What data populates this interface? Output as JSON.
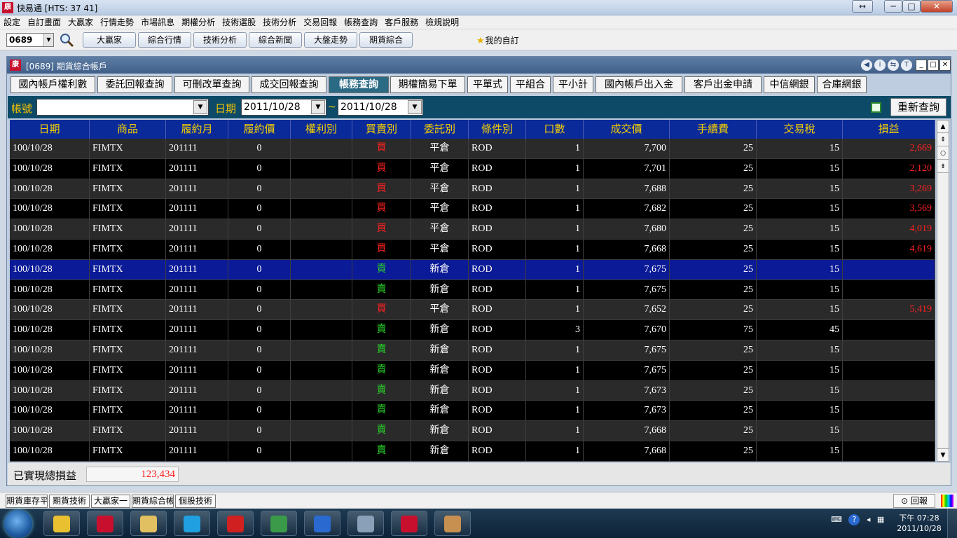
{
  "window": {
    "title": "快易通 [HTS: 37 41]",
    "controls": {
      "restore": "↔",
      "minimize": "─",
      "maximize": "□",
      "close": "✕"
    }
  },
  "menu": [
    "設定",
    "自訂畫面",
    "大贏家",
    "行情走勢",
    "市場訊息",
    "期權分析",
    "技術選股",
    "技術分析",
    "交易回報",
    "帳務查詢",
    "客戶服務",
    "檢規說明"
  ],
  "toolbar": {
    "stock_code": "0689",
    "buttons": [
      "大贏家",
      "綜合行情",
      "技術分析",
      "綜合新聞",
      "大盤走勢",
      "期貨綜合"
    ],
    "favorites_label": "我的自訂"
  },
  "subwindow": {
    "title": "[0689] 期貨綜合帳戶",
    "tabs": [
      "國內帳戶權利數",
      "委託回報查詢",
      "可刪改單查詢",
      "成交回報查詢",
      "帳務查詢",
      "期權簡易下單",
      "平單式",
      "平組合",
      "平小計",
      "國內帳戶出入金",
      "客戶出金申請",
      "中信網銀",
      "合庫網銀"
    ],
    "active_tab": "帳務查詢"
  },
  "filter": {
    "account_label": "帳號",
    "account_value": "",
    "date_label": "日期",
    "date_from": "2011/10/28",
    "separator": "~",
    "date_to": "2011/10/28",
    "requery_label": "重新查詢"
  },
  "table": {
    "columns": [
      "日期",
      "商品",
      "履約月",
      "履約價",
      "權利別",
      "買賣別",
      "委託別",
      "條件別",
      "口數",
      "成交價",
      "手續費",
      "交易稅",
      "損益"
    ],
    "rows": [
      [
        "100/10/28",
        "FIMTX",
        "201111",
        "0",
        "",
        "買",
        "平倉",
        "ROD",
        "1",
        "7,700",
        "25",
        "15",
        "2,669"
      ],
      [
        "100/10/28",
        "FIMTX",
        "201111",
        "0",
        "",
        "買",
        "平倉",
        "ROD",
        "1",
        "7,701",
        "25",
        "15",
        "2,120"
      ],
      [
        "100/10/28",
        "FIMTX",
        "201111",
        "0",
        "",
        "買",
        "平倉",
        "ROD",
        "1",
        "7,688",
        "25",
        "15",
        "3,269"
      ],
      [
        "100/10/28",
        "FIMTX",
        "201111",
        "0",
        "",
        "買",
        "平倉",
        "ROD",
        "1",
        "7,682",
        "25",
        "15",
        "3,569"
      ],
      [
        "100/10/28",
        "FIMTX",
        "201111",
        "0",
        "",
        "買",
        "平倉",
        "ROD",
        "1",
        "7,680",
        "25",
        "15",
        "4,019"
      ],
      [
        "100/10/28",
        "FIMTX",
        "201111",
        "0",
        "",
        "買",
        "平倉",
        "ROD",
        "1",
        "7,668",
        "25",
        "15",
        "4,619"
      ],
      [
        "100/10/28",
        "FIMTX",
        "201111",
        "0",
        "",
        "賣",
        "新倉",
        "ROD",
        "1",
        "7,675",
        "25",
        "15",
        ""
      ],
      [
        "100/10/28",
        "FIMTX",
        "201111",
        "0",
        "",
        "賣",
        "新倉",
        "ROD",
        "1",
        "7,675",
        "25",
        "15",
        ""
      ],
      [
        "100/10/28",
        "FIMTX",
        "201111",
        "0",
        "",
        "買",
        "平倉",
        "ROD",
        "1",
        "7,652",
        "25",
        "15",
        "5,419"
      ],
      [
        "100/10/28",
        "FIMTX",
        "201111",
        "0",
        "",
        "賣",
        "新倉",
        "ROD",
        "3",
        "7,670",
        "75",
        "45",
        ""
      ],
      [
        "100/10/28",
        "FIMTX",
        "201111",
        "0",
        "",
        "賣",
        "新倉",
        "ROD",
        "1",
        "7,675",
        "25",
        "15",
        ""
      ],
      [
        "100/10/28",
        "FIMTX",
        "201111",
        "0",
        "",
        "賣",
        "新倉",
        "ROD",
        "1",
        "7,675",
        "25",
        "15",
        ""
      ],
      [
        "100/10/28",
        "FIMTX",
        "201111",
        "0",
        "",
        "賣",
        "新倉",
        "ROD",
        "1",
        "7,673",
        "25",
        "15",
        ""
      ],
      [
        "100/10/28",
        "FIMTX",
        "201111",
        "0",
        "",
        "賣",
        "新倉",
        "ROD",
        "1",
        "7,673",
        "25",
        "15",
        ""
      ],
      [
        "100/10/28",
        "FIMTX",
        "201111",
        "0",
        "",
        "賣",
        "新倉",
        "ROD",
        "1",
        "7,668",
        "25",
        "15",
        ""
      ],
      [
        "100/10/28",
        "FIMTX",
        "201111",
        "0",
        "",
        "賣",
        "新倉",
        "ROD",
        "1",
        "7,668",
        "25",
        "15",
        ""
      ]
    ],
    "selected_row": 6
  },
  "footer": {
    "total_label": "已實現總損益",
    "total_value": "123,434"
  },
  "bottom_tabs": [
    "期貨庫存平倉",
    "期貨技術",
    "大贏家一",
    "期貨綜合帳戶",
    "個股技術"
  ],
  "report_label": "回報",
  "taskbar": {
    "apps": [
      "chrome-icon",
      "kuaiyitong-icon",
      "explorer-icon",
      "skype-icon",
      "dice-icon",
      "network-icon",
      "teamviewer-icon",
      "calculator-icon",
      "kuaiyitong2-icon",
      "paint-icon"
    ],
    "clock_time": "下午 07:28",
    "clock_date": "2011/10/28"
  },
  "colors": {
    "buy": "#ff2020",
    "sell": "#28d028",
    "header_text": "#f5d000",
    "header_bg": "#0a2a9a",
    "selected_row": "#0b1a96"
  }
}
